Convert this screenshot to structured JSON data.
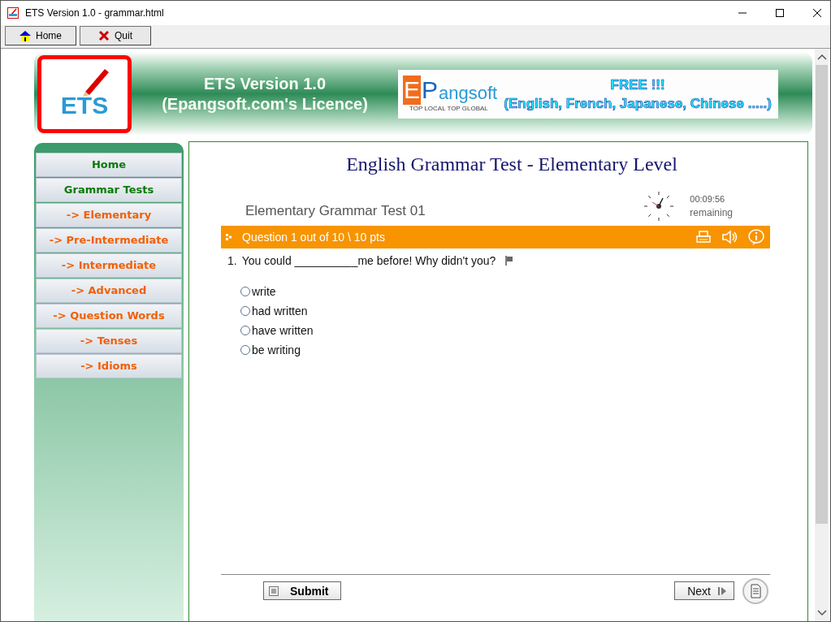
{
  "window": {
    "title": "ETS Version 1.0 - grammar.html"
  },
  "toolbar": [
    {
      "label": "Home",
      "kind": "home"
    },
    {
      "label": "Quit",
      "kind": "quit"
    }
  ],
  "header": {
    "logo_text": "ETS",
    "title": "ETS Version 1.0",
    "subtitle": "(Epangsoft.com's Licence)",
    "banner": {
      "brand_parts": [
        "E",
        "P",
        "angsoft"
      ],
      "tagline": "TOP LOCAL TOP GLOBAL",
      "headline": "FREE !!!",
      "languages": "(English, French, Japanese, Chinese .....)"
    }
  },
  "sidebar": {
    "items": [
      {
        "label": "Home",
        "kind": "section"
      },
      {
        "label": "Grammar Tests",
        "kind": "section"
      },
      {
        "label": "-> Elementary",
        "kind": "sub"
      },
      {
        "label": "-> Pre-Intermediate",
        "kind": "sub"
      },
      {
        "label": "-> Intermediate",
        "kind": "sub"
      },
      {
        "label": "-> Advanced",
        "kind": "sub"
      },
      {
        "label": "-> Question Words",
        "kind": "sub"
      },
      {
        "label": "-> Tenses",
        "kind": "sub"
      },
      {
        "label": "-> Idioms",
        "kind": "sub"
      }
    ]
  },
  "main": {
    "title": "English Grammar Test - Elementary Level",
    "test_name": "Elementary Grammar Test 01",
    "timer": {
      "time": "00:09:56",
      "label": "remaining"
    },
    "question_bar": "Question 1 out of 10 \\ 10 pts",
    "question": {
      "number": "1.",
      "text": "You could __________me before! Why didn't you?"
    },
    "options": [
      {
        "label": "write",
        "selected": false
      },
      {
        "label": "had written",
        "selected": false
      },
      {
        "label": "have written",
        "selected": false
      },
      {
        "label": "be writing",
        "selected": false
      }
    ],
    "buttons": [
      {
        "label": "Submit",
        "kind": "submit"
      },
      {
        "label": "Next",
        "kind": "next"
      }
    ]
  }
}
